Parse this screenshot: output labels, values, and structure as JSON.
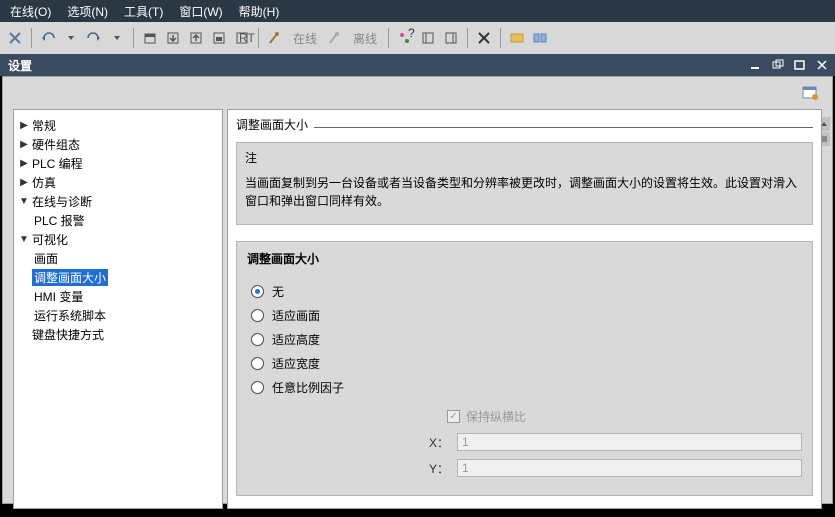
{
  "menubar": {
    "online": "在线(O)",
    "options": "选项(N)",
    "tools": "工具(T)",
    "window": "窗口(W)",
    "help": "帮助(H)"
  },
  "toolbar": {
    "text_online": "在线",
    "text_offline": "离线"
  },
  "title": "设置",
  "tree": {
    "general": "常规",
    "hardware": "硬件组态",
    "plc": "PLC 编程",
    "sim": "仿真",
    "diag": "在线与诊断",
    "plc_alarm": "PLC 报警",
    "vis": "可视化",
    "screen": "画面",
    "resize": "调整画面大小",
    "hmi_var": "HMI 变量",
    "script": "运行系统脚本",
    "keyboard": "键盘快捷方式"
  },
  "content": {
    "header": "调整画面大小",
    "note_title": "注",
    "note_body": "当画面复制到另一台设备或者当设备类型和分辨率被更改时，调整画面大小的设置将生效。此设置对滑入窗口和弹出窗口同样有效。",
    "form_title": "调整画面大小",
    "r1": "无",
    "r2": "适应画面",
    "r3": "适应高度",
    "r4": "适应宽度",
    "r5": "任意比例因子",
    "keep_ratio": "保持纵横比",
    "x_label": "X：",
    "y_label": "Y：",
    "x_val": "1",
    "y_val": "1"
  }
}
